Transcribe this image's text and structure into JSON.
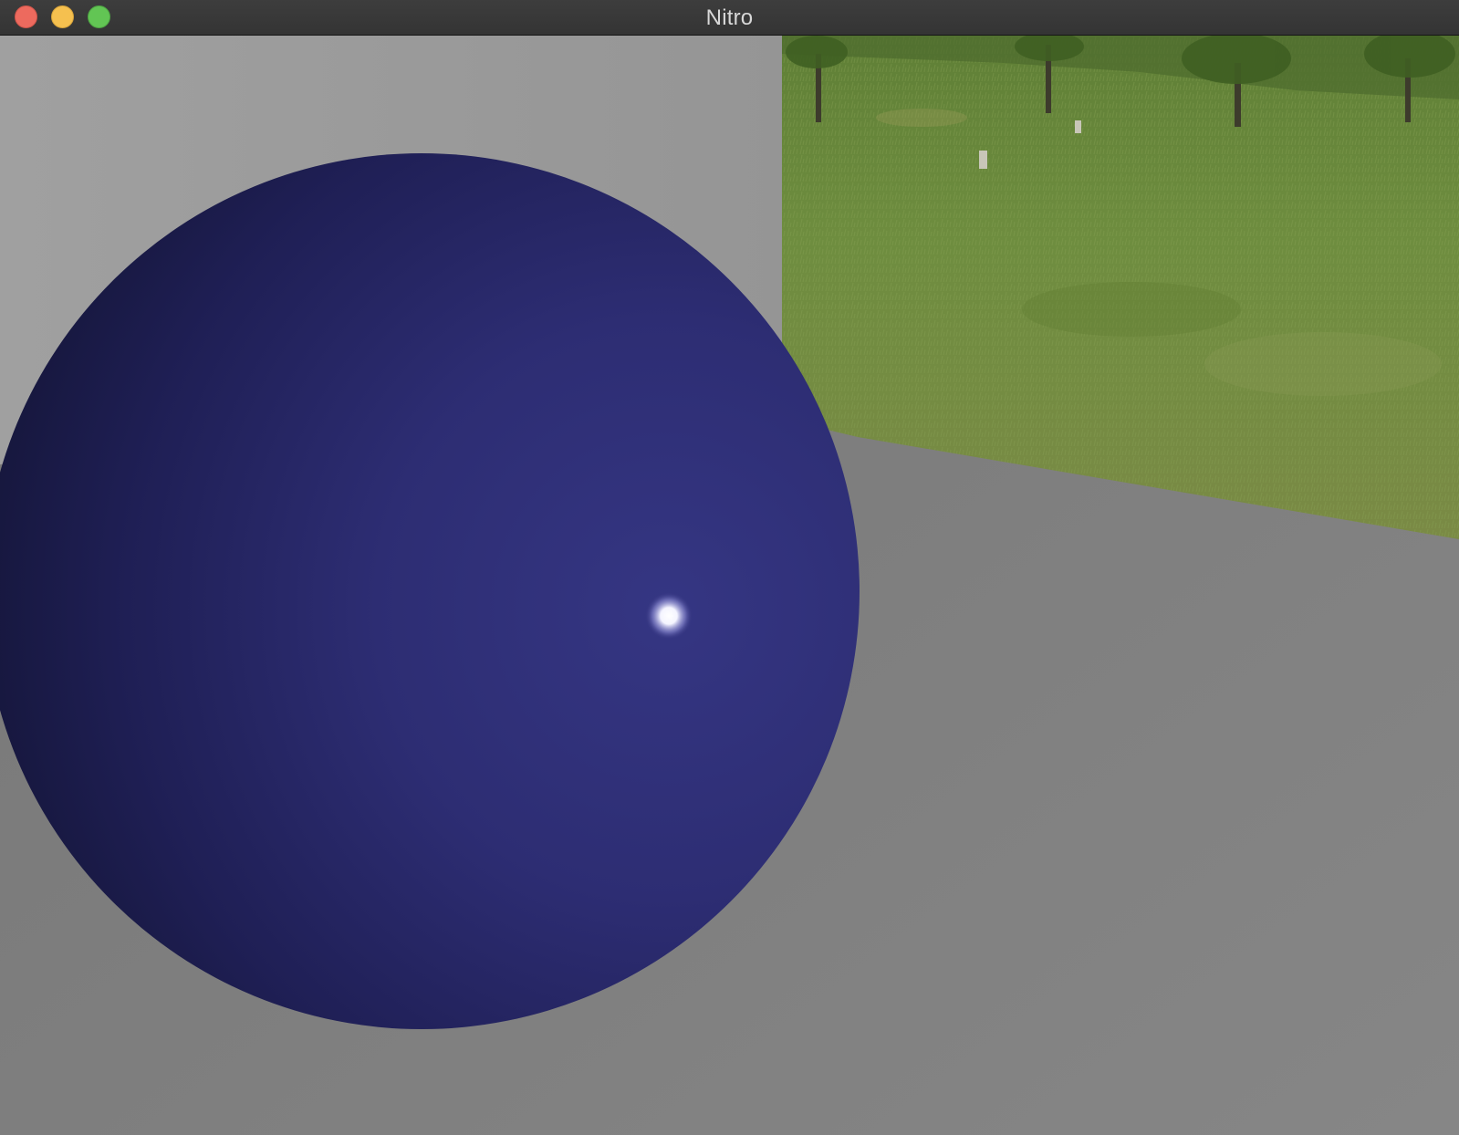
{
  "window": {
    "title": "Nitro",
    "controls": {
      "close_color": "#ed6a5e",
      "minimize_color": "#f5c04f",
      "zoom_color": "#62c554"
    }
  },
  "scene": {
    "objects": [
      "sphere-icon",
      "back-wall",
      "floor-plane",
      "grass-photo-panel"
    ],
    "colors": {
      "back_wall": "#9a9a9a",
      "floor": "#7f7f7f",
      "sphere_light": "#34347f",
      "sphere_dark": "#10122b",
      "highlight": "#ffffff",
      "grass": "#6f8c3c"
    }
  }
}
